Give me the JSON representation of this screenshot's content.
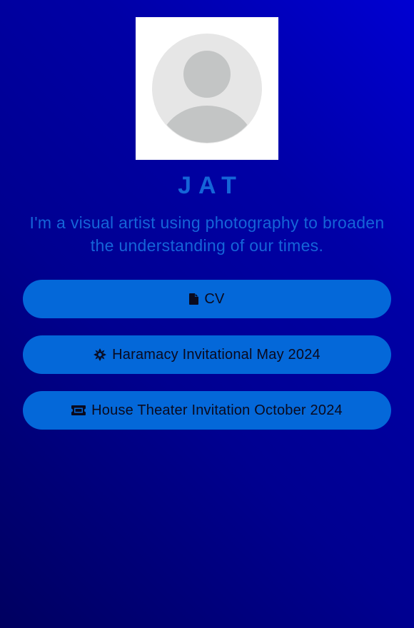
{
  "profile": {
    "name": "JAT",
    "bio": "I'm a visual artist using photography to broaden the understanding of our times.",
    "avatar_icon": "default-user-avatar-icon"
  },
  "links": [
    {
      "label": "CV",
      "icon": "document-icon"
    },
    {
      "label": "Haramacy Invitational May 2024",
      "icon": "sun-icon"
    },
    {
      "label": "House Theater Invitation October 2024",
      "icon": "ticket-icon"
    }
  ],
  "colors": {
    "background_top_right": "#0000d2",
    "background_bottom_left": "#000060",
    "accent_text": "#1565d8",
    "button_background": "#0468d9",
    "button_text": "#0a0a1e"
  }
}
